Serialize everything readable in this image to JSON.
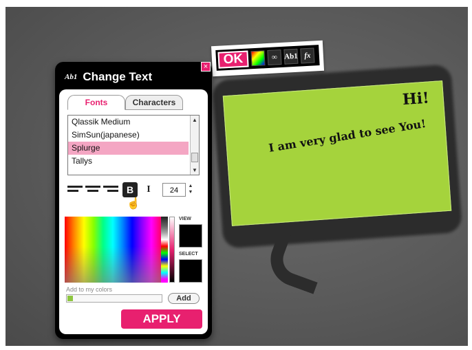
{
  "toolbar": {
    "ok_label": "OK",
    "icons": [
      "palette-icon",
      "link-icon",
      "text-icon",
      "fx-icon"
    ],
    "text_icon_label": "Ab1",
    "fx_label": "fx"
  },
  "panel": {
    "title": "Change Text",
    "title_icon": "Ab1",
    "close_glyph": "×",
    "tabs": [
      "Fonts",
      "Characters"
    ],
    "fonts": [
      "Qlassik Medium",
      "SimSun(japanese)",
      "Splurge",
      "Tallys"
    ],
    "selected_font": "Splurge",
    "bold_label": "B",
    "italic_label": "I",
    "font_size": "24",
    "view_label": "VIEW",
    "select_label": "SELECT",
    "my_colors_label": "Add to my colors",
    "add_label": "Add",
    "apply_label": "APPLY"
  },
  "bubble": {
    "greeting": "Hi!",
    "message": "I am very glad to see You!"
  },
  "colors": {
    "accent": "#e8206f",
    "bubble": "#a5d33c"
  }
}
